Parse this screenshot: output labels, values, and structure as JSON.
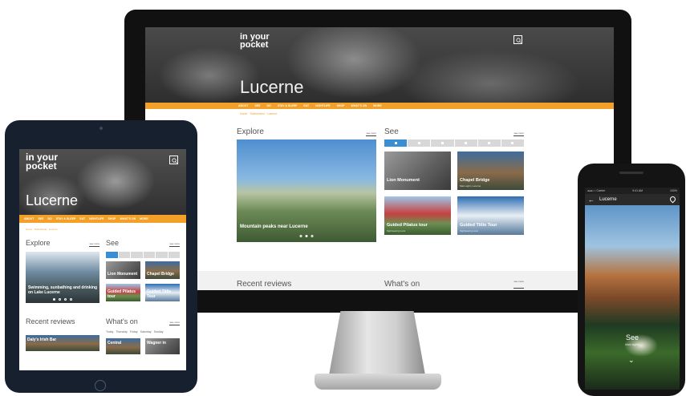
{
  "brand": {
    "logo_line1": "in your",
    "logo_line2": "pocket"
  },
  "city": "Lucerne",
  "desktop": {
    "nav": [
      "ABOUT",
      "SEE",
      "DO",
      "STAY & SLEEP",
      "EAT",
      "NIGHTLIFE",
      "SHOP",
      "WHAT'S ON",
      "MORE"
    ],
    "breadcrumb": "Home · Switzerland · Lucerne",
    "explore": {
      "title": "Explore",
      "see_more": "see more",
      "caption": "Mountain peaks near Lucerne"
    },
    "see": {
      "title": "See",
      "see_more": "see more",
      "tiles": [
        {
          "title": "Lion Monument",
          "sub": ""
        },
        {
          "title": "Chapel Bridge",
          "sub": "Main sight, Lucerne"
        },
        {
          "title": "Guided Pilatus tour",
          "sub": "Sightseeing tours"
        },
        {
          "title": "Guided Titlis Tour",
          "sub": "Sightseeing tours"
        }
      ]
    },
    "recent_reviews": "Recent reviews",
    "whats_on": "What's on",
    "see_more": "see more"
  },
  "tablet": {
    "nav": [
      "ABOUT",
      "SEE",
      "DO",
      "STAY & SLEEP",
      "EAT",
      "NIGHTLIFE",
      "SHOP",
      "WHAT'S ON",
      "MORE"
    ],
    "breadcrumb": "Home · Switzerland · Lucerne",
    "explore": {
      "title": "Explore",
      "see_more": "see more",
      "caption": "Swimming, sunbathing and drinking on Lake Lucerne"
    },
    "see": {
      "title": "See",
      "see_more": "see more",
      "tiles": [
        "Lion Monument",
        "Chapel Bridge",
        "Guided Pilatus tour",
        "Guided Titlis Tour"
      ]
    },
    "recent_reviews": "Recent reviews",
    "whats_on": "What's on",
    "see_more": "see more",
    "days": [
      "Today",
      "Thursday",
      "Friday",
      "Saturday",
      "Sunday"
    ],
    "review_item": "Daly's Irish Bar",
    "event_items": [
      "Central",
      "Wagner in"
    ]
  },
  "phone": {
    "carrier": "●●●○○ Carrier",
    "time": "9:41 AM",
    "battery": "100%",
    "back": "←",
    "title": "Lucerne",
    "see": "See",
    "sub": "Main sights",
    "chevron": "⌄"
  }
}
